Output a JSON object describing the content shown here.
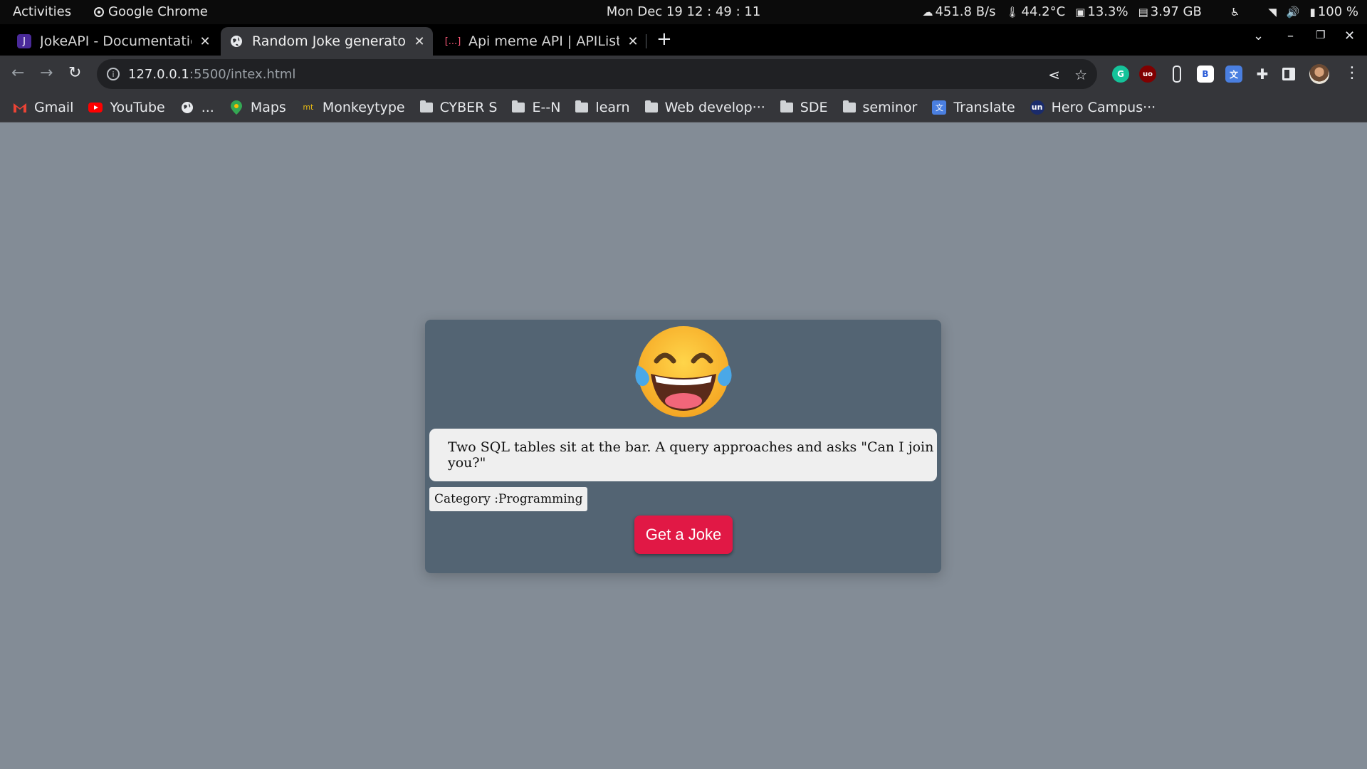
{
  "system_bar": {
    "activities": "Activities",
    "app_name": "Google Chrome",
    "clock": "Mon Dec 19  12 : 49 : 11",
    "net_speed": "451.8 B/s",
    "temperature": "44.2°C",
    "cpu": "13.3%",
    "memory": "3.97 GB",
    "battery": "100 %"
  },
  "tabs": [
    {
      "title": "JokeAPI - Documentation",
      "active": false,
      "favicon": "J"
    },
    {
      "title": "Random Joke generator",
      "active": true,
      "favicon": "globe"
    },
    {
      "title": "Api meme API | APIList.fun",
      "active": false,
      "favicon": "[...]"
    }
  ],
  "address_bar": {
    "host": "127.0.0.1",
    "path": ":5500/intex.html"
  },
  "bookmarks": [
    {
      "label": "Gmail",
      "icon": "gmail-icon"
    },
    {
      "label": "YouTube",
      "icon": "youtube-icon"
    },
    {
      "label": "...",
      "icon": "globe-icon"
    },
    {
      "label": "Maps",
      "icon": "maps-icon"
    },
    {
      "label": "Monkeytype",
      "icon": "monkeytype-icon"
    },
    {
      "label": "CYBER S",
      "icon": "folder-icon"
    },
    {
      "label": "E--N",
      "icon": "folder-icon"
    },
    {
      "label": "learn",
      "icon": "folder-icon"
    },
    {
      "label": "Web develop···",
      "icon": "folder-icon"
    },
    {
      "label": "SDE",
      "icon": "folder-icon"
    },
    {
      "label": "seminor",
      "icon": "folder-icon"
    },
    {
      "label": "Translate",
      "icon": "translate-icon"
    },
    {
      "label": "Hero Campus···",
      "icon": "unstop-icon"
    }
  ],
  "joke_card": {
    "emoji": "face-with-tears-of-joy",
    "joke_text": "Two SQL tables sit at the bar. A query approaches and asks \"Can I join you?\"",
    "category": "Category :Programming",
    "button_label": "Get a Joke",
    "button_color": "#e11845",
    "card_color": "#536473",
    "page_background": "#838c96"
  }
}
